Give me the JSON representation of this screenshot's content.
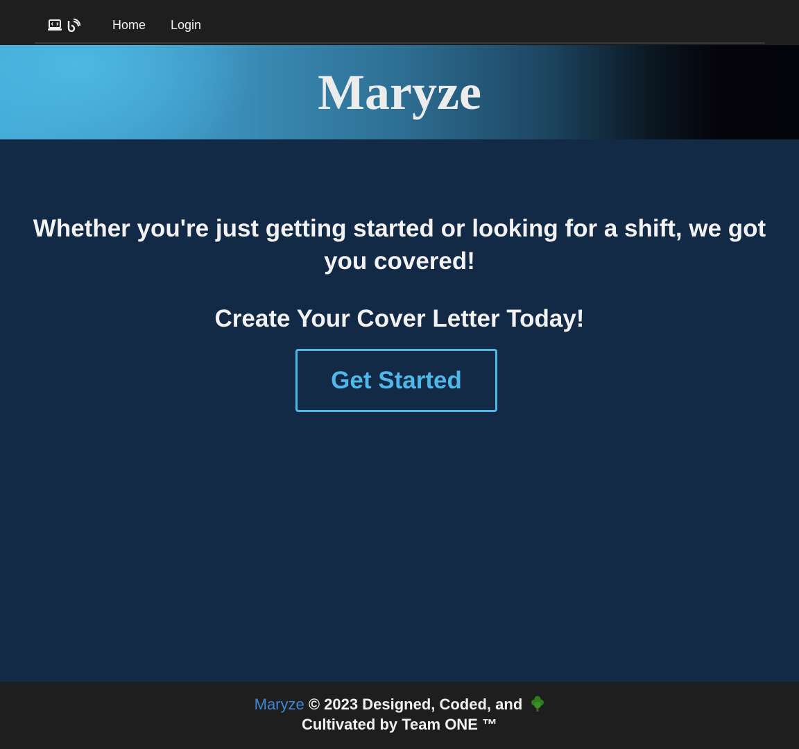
{
  "nav": {
    "icons": [
      "laptop-code-icon",
      "blog-icon"
    ],
    "home_label": "Home",
    "login_label": "Login"
  },
  "banner": {
    "title": "Maryze"
  },
  "main": {
    "tagline": "Whether you're just getting started or looking for a shift, we got you covered!",
    "cta_heading": "Create Your Cover Letter Today!",
    "cta_button_label": "Get Started"
  },
  "footer": {
    "brand": "Maryze",
    "line1_text": " © 2023 Designed, Coded, and ",
    "line2_text": "Cultivated by Team ONE ™",
    "tree_icon": "tree-icon"
  },
  "colors": {
    "navbar_bg": "#1e1e1e",
    "page_bg": "#122a45",
    "accent": "#4fb8e8",
    "footer_brand": "#3f87d6"
  }
}
